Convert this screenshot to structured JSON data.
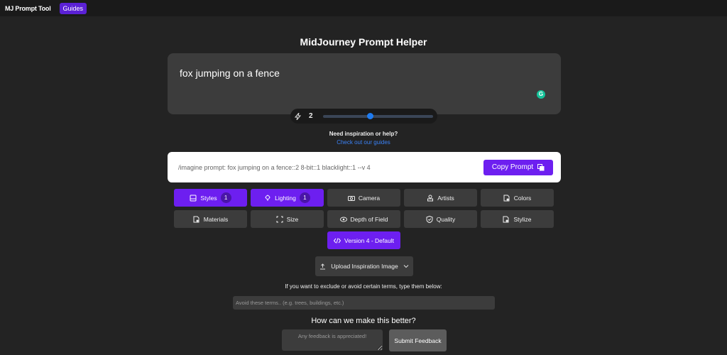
{
  "nav": {
    "brand": "MJ Prompt Tool",
    "guides": "Guides"
  },
  "title": "MidJourney Prompt Helper",
  "prompt": {
    "text": "fox jumping on a fence",
    "weight": "2",
    "weight_fraction": 0.4
  },
  "help": {
    "question": "Need inspiration or help?",
    "link": "Check out our guides"
  },
  "output": {
    "text": "/imagine prompt: fox jumping on a fence::2 8-bit::1 blacklight::1 --v 4",
    "copy_label": "Copy Prompt"
  },
  "categories": [
    {
      "label": "Styles",
      "count": "1",
      "active": true,
      "icon": "image-icon"
    },
    {
      "label": "Lighting",
      "count": "1",
      "active": true,
      "icon": "bulb-icon"
    },
    {
      "label": "Camera",
      "icon": "camera-icon"
    },
    {
      "label": "Artists",
      "icon": "user-icon"
    },
    {
      "label": "Colors",
      "icon": "palette-icon"
    },
    {
      "label": "Materials",
      "icon": "palette-icon"
    },
    {
      "label": "Size",
      "icon": "expand-icon"
    },
    {
      "label": "Depth of Field",
      "icon": "eye-icon"
    },
    {
      "label": "Quality",
      "icon": "shield-icon"
    },
    {
      "label": "Stylize",
      "icon": "palette-icon"
    }
  ],
  "version": "Version 4 - Default",
  "upload": "Upload Inspiration Image",
  "exclude": {
    "label": "If you want to exclude or avoid certain terms, type them below:",
    "placeholder": "Avoid these terms.. (e.g. trees, buildings, etc.)"
  },
  "feedback": {
    "heading": "How can we make this better?",
    "placeholder": "Any feedback is appreciated!",
    "submit": "Submit Feedback"
  },
  "colors": {
    "accent": "#6d1ff0",
    "background": "#232323",
    "link": "#3b82f6"
  }
}
